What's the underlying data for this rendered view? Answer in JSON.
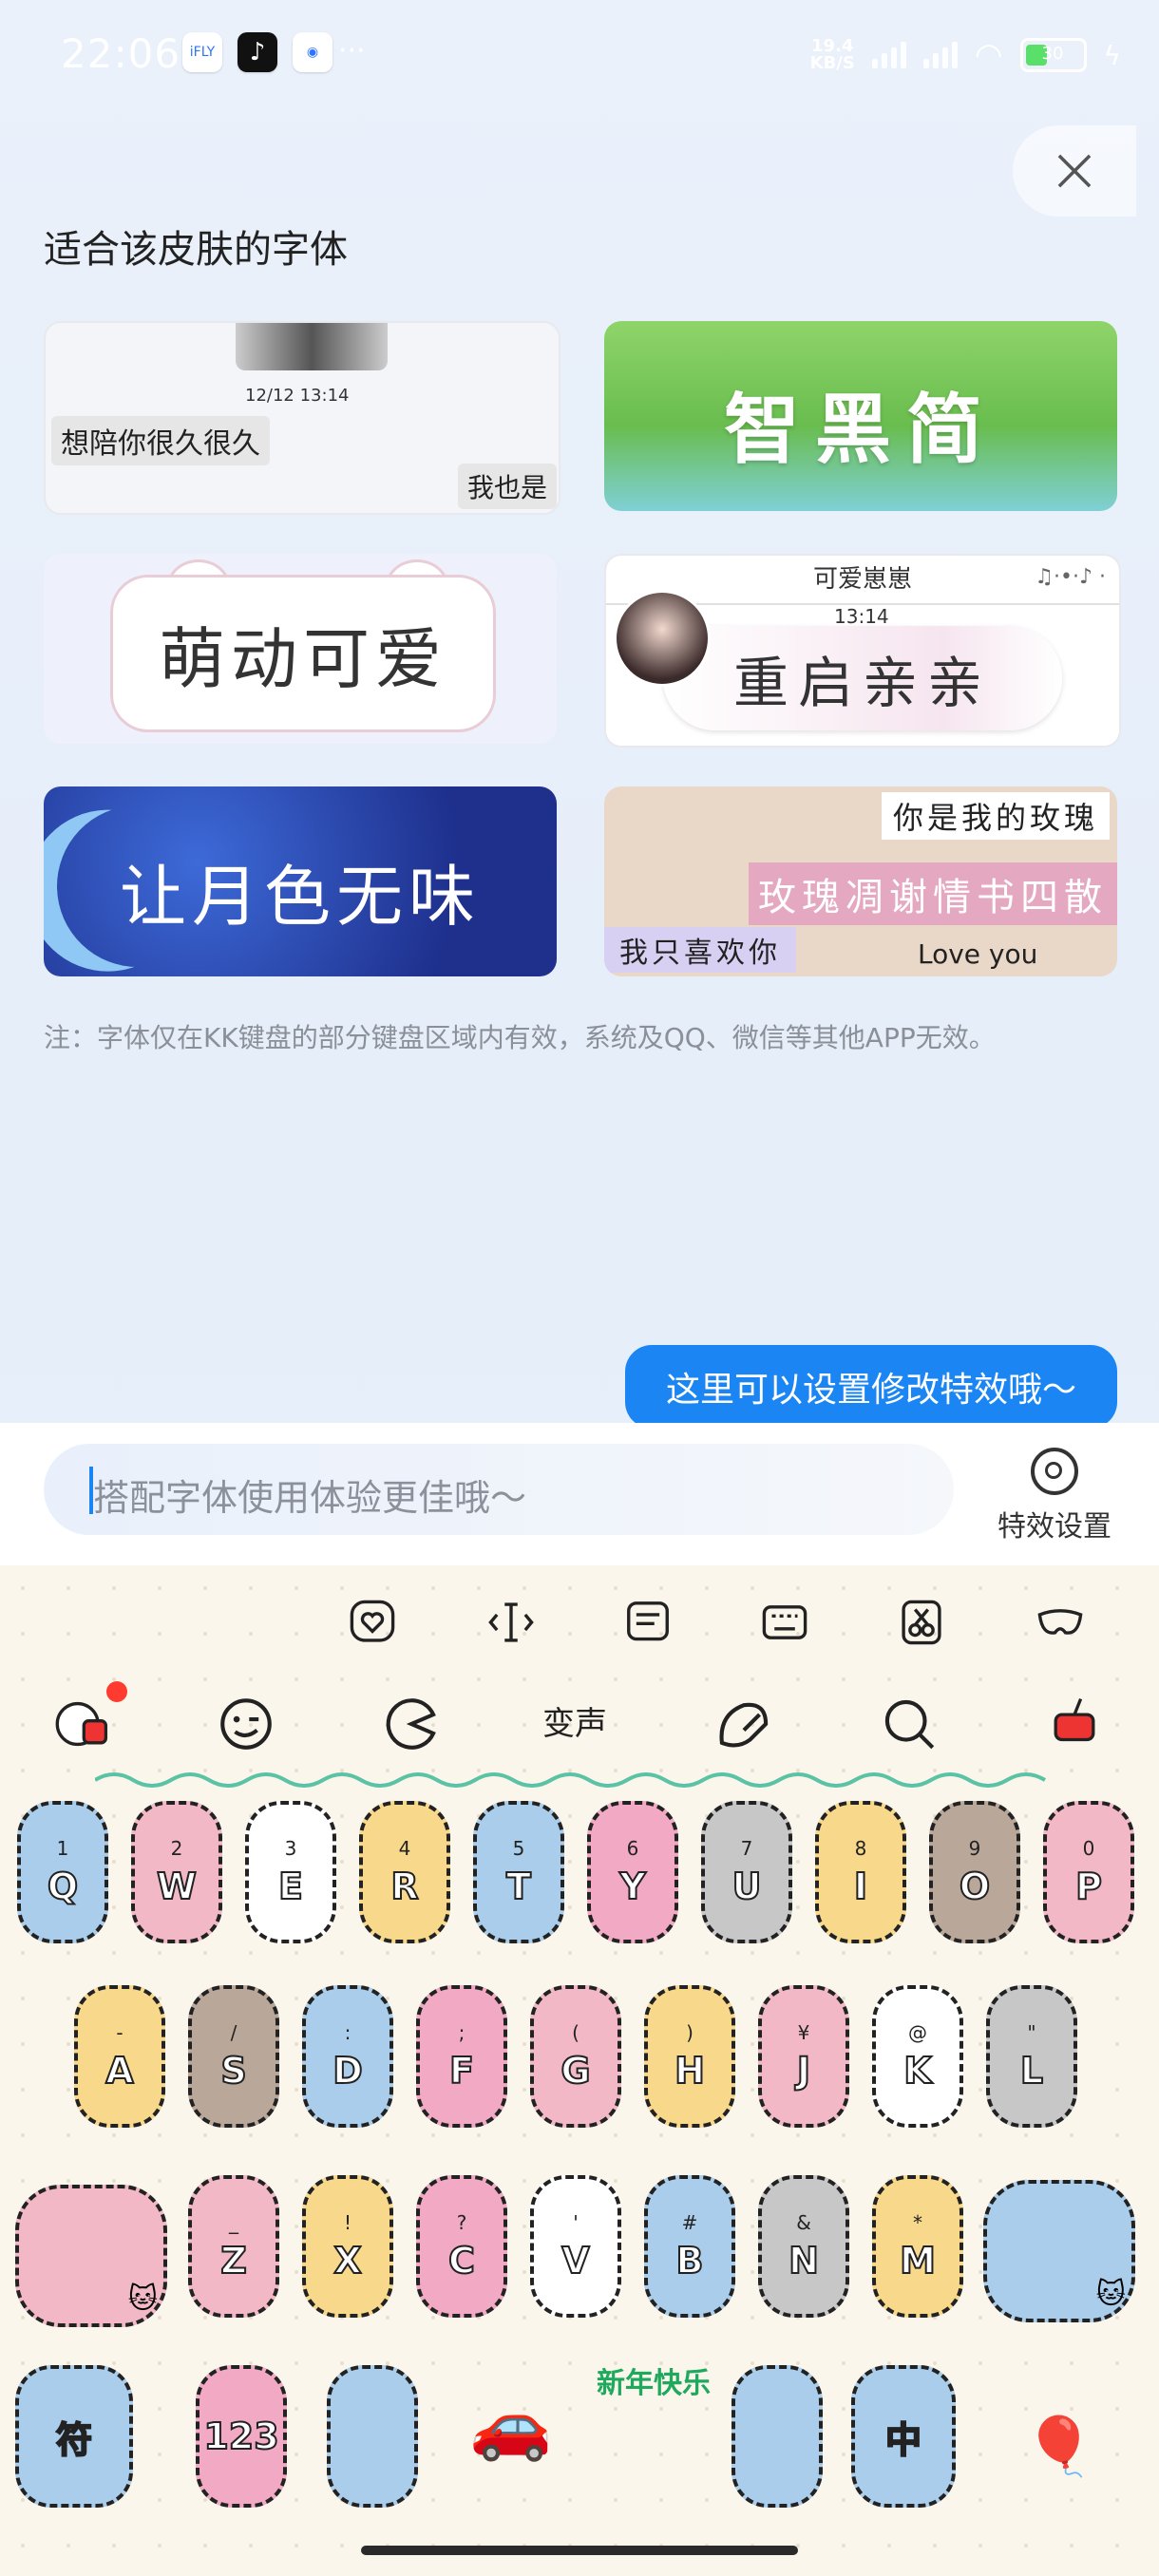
{
  "status_bar": {
    "time": "22:06",
    "apps": [
      "iFLY",
      "TikTok",
      "GetFlow"
    ],
    "more": "···",
    "speed_value": "19.4",
    "speed_unit": "KB/S",
    "hd": "HD",
    "battery": "30"
  },
  "page": {
    "title": "适合该皮肤的字体",
    "note": "注：字体仅在KK键盘的部分键盘区域内有效，系统及QQ、微信等其他APP无效。"
  },
  "fonts": [
    {
      "id": "f1",
      "date": "12/12 13:14",
      "msg1": "想陪你很久很久",
      "msg2": "我也是"
    },
    {
      "id": "f2",
      "text": "智黑简"
    },
    {
      "id": "f3",
      "text": "萌动可爱"
    },
    {
      "id": "f4",
      "header": "可爱崽崽",
      "notes": "♫·•·♪ ·",
      "time": "13:14",
      "text": "重启亲亲"
    },
    {
      "id": "f5",
      "text": "让月色无味"
    },
    {
      "id": "f6",
      "t1": "你是我的玫瑰",
      "t2": "玫瑰凋谢情书四散",
      "t3": "我只喜欢你",
      "t4": "Love you"
    }
  ],
  "tooltip": "这里可以设置修改特效哦～",
  "input": {
    "placeholder": "搭配字体使用体验更佳哦～",
    "effects_label": "特效设置"
  },
  "keyboard": {
    "toolbar_icons": [
      "emoji-heart-icon",
      "text-cursor-icon",
      "clipboard-icon",
      "keyboard-icon",
      "scissors-icon",
      "mask-icon"
    ],
    "function_row": {
      "voice_change": "变声"
    },
    "newyear_text": "新年快乐",
    "row1": [
      {
        "l": "Q",
        "n": "1",
        "c": "#a9cdea"
      },
      {
        "l": "W",
        "n": "2",
        "c": "#f2b8c6"
      },
      {
        "l": "E",
        "n": "3",
        "c": "#ffffff"
      },
      {
        "l": "R",
        "n": "4",
        "c": "#f8d88a"
      },
      {
        "l": "T",
        "n": "5",
        "c": "#a9cdea"
      },
      {
        "l": "Y",
        "n": "6",
        "c": "#f2a9c4"
      },
      {
        "l": "U",
        "n": "7",
        "c": "#c7c7c7"
      },
      {
        "l": "I",
        "n": "8",
        "c": "#f8d88a"
      },
      {
        "l": "O",
        "n": "9",
        "c": "#b9a79a"
      },
      {
        "l": "P",
        "n": "0",
        "c": "#f2b8c6"
      }
    ],
    "row2": [
      {
        "l": "A",
        "n": "-",
        "c": "#f8d88a"
      },
      {
        "l": "S",
        "n": "/",
        "c": "#b9a79a"
      },
      {
        "l": "D",
        "n": ":",
        "c": "#a9cdea"
      },
      {
        "l": "F",
        "n": ";",
        "c": "#f2a9c4"
      },
      {
        "l": "G",
        "n": "(",
        "c": "#f2b8c6"
      },
      {
        "l": "H",
        "n": ")",
        "c": "#f8d88a"
      },
      {
        "l": "J",
        "n": "¥",
        "c": "#f2b8c6"
      },
      {
        "l": "K",
        "n": "@",
        "c": "#ffffff"
      },
      {
        "l": "L",
        "n": "\"",
        "c": "#c7c7c7"
      }
    ],
    "row3": [
      {
        "l": "Z",
        "n": "_",
        "c": "#f2b8c6"
      },
      {
        "l": "X",
        "n": "!",
        "c": "#f8d88a"
      },
      {
        "l": "C",
        "n": "?",
        "c": "#f2a9c4"
      },
      {
        "l": "V",
        "n": "'",
        "c": "#ffffff"
      },
      {
        "l": "B",
        "n": "#",
        "c": "#a9cdea"
      },
      {
        "l": "N",
        "n": "&",
        "c": "#c7c7c7"
      },
      {
        "l": "M",
        "n": "*",
        "c": "#f8d88a"
      }
    ],
    "row4": [
      {
        "l": "符",
        "n": "",
        "c": "#a9cdea"
      },
      {
        "l": "123",
        "n": "",
        "c": "#f2a9c4"
      },
      {
        "l": "",
        "n": "",
        "c": "#a9cdea"
      },
      {
        "l": "",
        "n": "",
        "c": "#a9cdea"
      },
      {
        "l": "中",
        "n": "",
        "c": "#a9cdea"
      }
    ]
  },
  "colors": {
    "accent": "#1b86f3",
    "keyboard_bg": "#fbf6ec"
  }
}
